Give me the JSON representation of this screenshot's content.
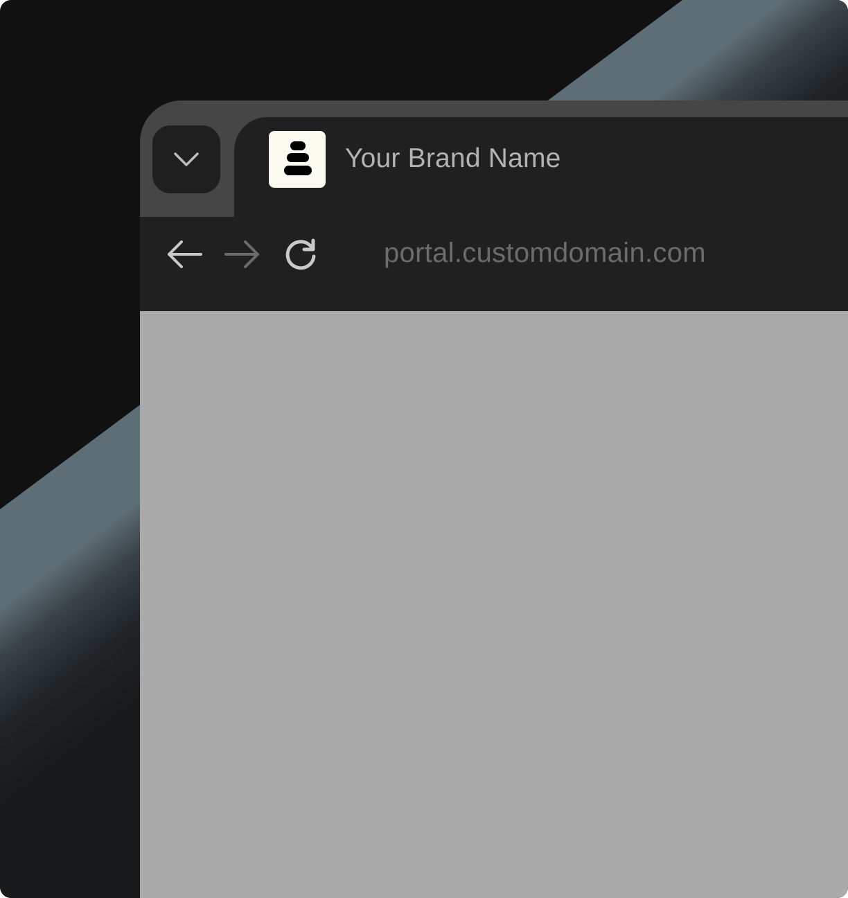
{
  "tab": {
    "title": "Your Brand Name",
    "menu_icon": "chevron-down-icon",
    "favicon_icon": "stacked-stones-icon"
  },
  "toolbar": {
    "back_icon": "arrow-left-icon",
    "forward_icon": "arrow-right-icon",
    "reload_icon": "reload-icon",
    "url": "portal.customdomain.com"
  },
  "colors": {
    "background": "#111112",
    "tabstrip": "#464646",
    "chrome": "#202020",
    "viewport": "#aaaaaa",
    "favicon_bg": "#fbfbf2",
    "title_text": "#b3b3b3",
    "url_text": "#6c6c6c"
  }
}
